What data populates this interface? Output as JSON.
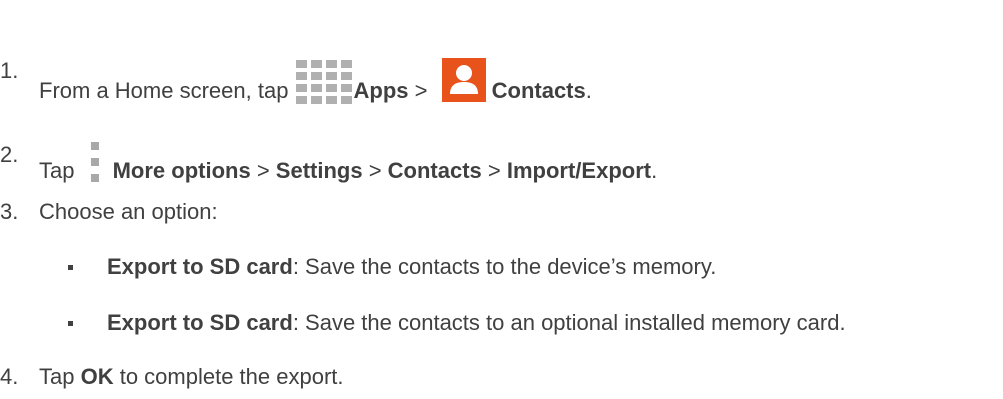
{
  "steps": [
    {
      "number": "1.",
      "text_pre": "From a Home screen, tap ",
      "apps_label": "Apps",
      "sep": " > ",
      "contacts_label": "Contacts",
      "end": "."
    },
    {
      "number": "2.",
      "text_pre": "Tap ",
      "more_options_label": "More options",
      "sep1": " > ",
      "settings_label": "Settings",
      "sep2": " > ",
      "contacts_label": "Contacts",
      "sep3": " > ",
      "import_export_label": "Import/Export",
      "end": "."
    },
    {
      "number": "3.",
      "text": "Choose an option:"
    },
    {
      "number": "4.",
      "text_pre": "Tap ",
      "ok_label": "OK",
      "text_post": " to complete the export."
    }
  ],
  "options": [
    {
      "label": "Export to SD card",
      "description": ": Save the contacts to the device’s memory."
    },
    {
      "label": "Export to SD card",
      "description": ": Save the contacts to an optional installed memory card."
    }
  ],
  "icons": {
    "apps": "apps-grid-icon",
    "contacts": "contacts-icon",
    "more_options": "more-options-icon"
  },
  "colors": {
    "text": "#404040",
    "contacts_icon_bg": "#e8531b",
    "icon_gray": "#b0b0b0"
  }
}
